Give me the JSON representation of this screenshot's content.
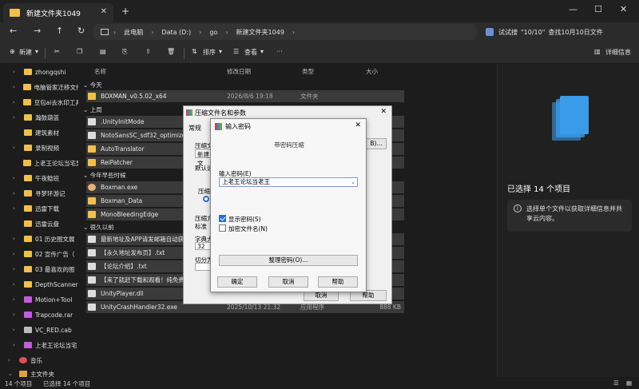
{
  "window": {
    "tab_title": "新建文件夹1049",
    "tab_close": "✕",
    "new_tab": "+",
    "minimize": "—",
    "maximize": "☐",
    "close": "✕"
  },
  "nav": {
    "back": "←",
    "forward": "→",
    "up": "↑",
    "refresh": "↻",
    "breadcrumb": [
      "此电脑",
      "Data (D:)",
      "go",
      "新建文件夹1049"
    ],
    "search_hint": [
      "试试搜",
      "\"10/10\"",
      "查找10月10日文件"
    ]
  },
  "toolbar": {
    "new_label": "新建",
    "sort_label": "排序",
    "view_label": "查看",
    "more_label": "···",
    "details_label": "详细信息"
  },
  "sidebar": {
    "items": [
      {
        "label": "zhongqshi",
        "color": "#f0c04a"
      },
      {
        "label": "电脑管家迁移文件",
        "color": "#f0c04a"
      },
      {
        "label": "豆包ai去水印工具",
        "color": "#f0c04a"
      },
      {
        "label": "瀚鼓葫蓝",
        "color": "#f0c04a"
      },
      {
        "label": "建筑素材",
        "color": "#f0c04a"
      },
      {
        "label": "录制视频",
        "color": "#f0c04a"
      },
      {
        "label": "上老王论坛当宅男",
        "color": "#f0c04a"
      },
      {
        "label": "午夜鲶班",
        "color": "#f0c04a"
      },
      {
        "label": "寻梦环游记",
        "color": "#f0c04a"
      },
      {
        "label": "迅雷下载",
        "color": "#f0c04a"
      },
      {
        "label": "迅雷云盘",
        "color": "#f0c04a"
      },
      {
        "label": "01 历史图文展",
        "color": "#f0c04a"
      },
      {
        "label": "02 宣传广告（",
        "color": "#f0c04a"
      },
      {
        "label": "03 最喜欢的图",
        "color": "#f0c04a"
      },
      {
        "label": "DepthScanner",
        "color": "#f0c04a"
      },
      {
        "label": "Motion+Tool",
        "color": "#c45ae0"
      },
      {
        "label": "Trapcode.rar",
        "color": "#c45ae0"
      },
      {
        "label": "VC_RED.cab",
        "color": "#bbbbbb"
      },
      {
        "label": "上老王论坛当宅",
        "color": "#c45ae0"
      },
      {
        "label": "音乐",
        "color": "#e05050"
      },
      {
        "label": "主文件夹",
        "color": "#e0a040"
      }
    ]
  },
  "files": {
    "headers": {
      "name": "名称",
      "date": "修改日期",
      "type": "类型",
      "size": "大小"
    },
    "groups": {
      "today": "今天",
      "last_week": "上周",
      "earlier_year": "今年早些时候",
      "long_ago": "很久以前"
    },
    "rows": [
      {
        "name": "BOXMAN_v0.5.02_x64",
        "date": "2026/8/6 19:18",
        "type": "文件夹",
        "size": "",
        "color": "#f0c04a"
      },
      {
        "name": ".UnityInitMode",
        "date": "",
        "type": "",
        "size": "",
        "color": "#dddddd"
      },
      {
        "name": "NotoSansSC_sdf32_optimized",
        "date": "",
        "type": "",
        "size": "",
        "color": "#dddddd"
      },
      {
        "name": "AutoTranslator",
        "date": "",
        "type": "",
        "size": "",
        "color": "#f0c04a"
      },
      {
        "name": "ReiPatcher",
        "date": "",
        "type": "",
        "size": "",
        "color": "#f0c04a"
      },
      {
        "name": "Boxman.exe",
        "date": "",
        "type": "",
        "size": "",
        "color": "#e8b070"
      },
      {
        "name": "Boxman_Data",
        "date": "",
        "type": "",
        "size": "",
        "color": "#f0c04a"
      },
      {
        "name": "MonoBleedingEdge",
        "date": "",
        "type": "",
        "size": "",
        "color": "#f0c04a"
      },
      {
        "name": "最新地址及APP请发邮箱自动获取",
        "date": "",
        "type": "",
        "size": "",
        "color": "#dddddd"
      },
      {
        "name": "【永久地址发布页】.txt",
        "date": "",
        "type": "",
        "size": "",
        "color": "#dddddd"
      },
      {
        "name": "【论坛介绍】.txt",
        "date": "",
        "type": "",
        "size": "",
        "color": "#dddddd"
      },
      {
        "name": "【来了就赶下载和观看！纯免费！",
        "date": "",
        "type": "",
        "size": "",
        "color": "#dddddd"
      },
      {
        "name": "UnityPlayer.dll",
        "date": "",
        "type": "",
        "size": "",
        "color": "#dddddd"
      },
      {
        "name": "UnityCrashHandler32.exe",
        "date": "2025/10/13 21:32",
        "type": "应用程序",
        "size": "888 KB",
        "color": "#dddddd"
      }
    ]
  },
  "details": {
    "selected": "已选择 14 个项目",
    "info": "选择单个文件以获取详细信息并共享云内容。"
  },
  "status": {
    "count": "14 个项目",
    "selected": "已选择 14 个项目"
  },
  "dialog_archive": {
    "title": "压缩文件名和参数",
    "tab": "常规",
    "label_name": "压缩文",
    "value_name": "新建文",
    "label_default": "默认设",
    "label_format": "压缩文",
    "label_method": "压缩方",
    "value_method": "标准",
    "label_dict": "字典大小",
    "value_dict": "32",
    "label_split": "切分为",
    "browse_label": "B)...",
    "help_label": "帮助",
    "cancel_label": "取消",
    "ok_label": "确定"
  },
  "dialog_password": {
    "title": "输入密码",
    "heading": "带密码压缩",
    "label_password": "输入密码(E)",
    "value_password": "上老王论坛当老王",
    "show_password": "显示密码(S)",
    "encrypt_names": "加密文件名(N)",
    "organize_label": "整理密码(O)...",
    "ok_label": "确定",
    "cancel_label": "取消",
    "help_label": "帮助"
  }
}
